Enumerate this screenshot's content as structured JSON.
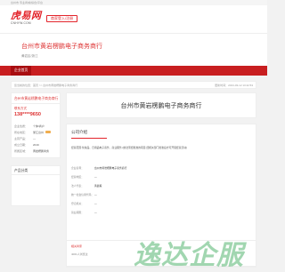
{
  "top_strip": {
    "text": "台州市·专业商城(综合)平台"
  },
  "header": {
    "logo_top": "虎易网",
    "logo_sub": "CNHYW.COM",
    "bind_button": "商家登入/注册"
  },
  "company": {
    "title": "台州市黄岩楞鹏电子商务商行",
    "location": "黄岩区/浙江"
  },
  "nav": {
    "item": "企业首页"
  },
  "breadcrumb": {
    "path": "您当前的位置：首页 >> 台州市黄岩楞鹏电子商务商行",
    "updated": "更新时间：2024-03-12 13:42:53"
  },
  "sidebar": {
    "card_title": "台州市黄岩楞鹏电子商务商行",
    "contact_label": "联系方式",
    "phone": "138****9650",
    "kv": [
      {
        "k": "企业性质：",
        "v": "个体/商户"
      },
      {
        "k": "所在地区：",
        "v": "浙江台州"
      },
      {
        "k": "主营产品：",
        "v": "—"
      },
      {
        "k": "成立日期：",
        "v": "2019"
      },
      {
        "k": "所属区域：",
        "v": "黄岩楞鹏商务"
      }
    ],
    "products_title": "产品分类"
  },
  "main": {
    "company_name": "台州市黄岩楞鹏电子商务商行",
    "intro_tab": "公司介绍",
    "intro_text": "经营范围:化妆品、日用品电子商务、商业服务.(依法须经批准的项目,经相关部门批准后方可开展经营活动)",
    "rows": [
      {
        "k": "企业名称：",
        "v": "台州市黄岩楞鹏电子商务商行"
      },
      {
        "k": "经营地区：",
        "v": "—"
      },
      {
        "k": "法人代表：",
        "v": "黄晨毅"
      },
      {
        "k": "统一社会信用代码：",
        "v": "—"
      },
      {
        "k": "登记机关：",
        "v": "—"
      },
      {
        "k": "营业期限：",
        "v": "—"
      }
    ],
    "call_button": "联系方式 138****9650",
    "chat_button": "在线联系"
  },
  "footer": {
    "ad_label": "相关商家",
    "people": "4001人浏览过"
  },
  "watermark": {
    "text": "逸达企服"
  }
}
